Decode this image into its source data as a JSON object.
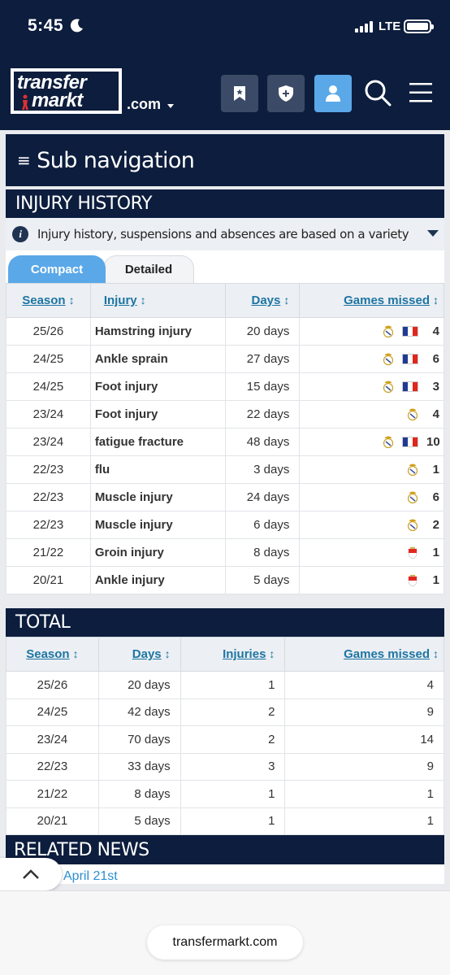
{
  "status_bar": {
    "time": "5:45",
    "network": "LTE"
  },
  "header": {
    "logo_line1": "transfer",
    "logo_line2": "markt",
    "domain": ".com"
  },
  "subnav": {
    "label": "Sub navigation"
  },
  "injury_history": {
    "title": "INJURY HISTORY",
    "info_text": "Injury history, suspensions and absences are based on a variety of media report..",
    "tabs": [
      "Compact",
      "Detailed"
    ],
    "columns": [
      "Season",
      "Injury",
      "Days",
      "Games missed"
    ],
    "rows": [
      {
        "season": "25/26",
        "injury": "Hamstring injury",
        "days": "20 days",
        "games": "4"
      },
      {
        "season": "24/25",
        "injury": "Ankle sprain",
        "days": "27 days",
        "games": "6"
      },
      {
        "season": "24/25",
        "injury": "Foot injury",
        "days": "15 days",
        "games": "3"
      },
      {
        "season": "23/24",
        "injury": "Foot injury",
        "days": "22 days",
        "games": "4"
      },
      {
        "season": "23/24",
        "injury": "fatigue fracture",
        "days": "48 days",
        "games": "10"
      },
      {
        "season": "22/23",
        "injury": "flu",
        "days": "3 days",
        "games": "1"
      },
      {
        "season": "22/23",
        "injury": "Muscle injury",
        "days": "24 days",
        "games": "6"
      },
      {
        "season": "22/23",
        "injury": "Muscle injury",
        "days": "6 days",
        "games": "2"
      },
      {
        "season": "21/22",
        "injury": "Groin injury",
        "days": "8 days",
        "games": "1"
      },
      {
        "season": "20/21",
        "injury": "Ankle injury",
        "days": "5 days",
        "games": "1"
      }
    ]
  },
  "total": {
    "title": "TOTAL",
    "columns": [
      "Season",
      "Days",
      "Injuries",
      "Games missed"
    ],
    "rows": [
      {
        "season": "25/26",
        "days": "20 days",
        "injuries": "1",
        "games": "4"
      },
      {
        "season": "24/25",
        "days": "42 days",
        "injuries": "2",
        "games": "9"
      },
      {
        "season": "23/24",
        "days": "70 days",
        "injuries": "2",
        "games": "14"
      },
      {
        "season": "22/23",
        "days": "33 days",
        "injuries": "3",
        "games": "9"
      },
      {
        "season": "21/22",
        "days": "8 days",
        "injuries": "1",
        "games": "1"
      },
      {
        "season": "20/21",
        "days": "5 days",
        "injuries": "1",
        "games": "1"
      }
    ]
  },
  "related_news": {
    "title": "RELATED NEWS",
    "first_date": "April 21st"
  },
  "browser": {
    "url": "transfermarkt.com"
  },
  "colors": {
    "navy": "#0c1d3d",
    "accent_blue": "#5aa8e8",
    "link_blue": "#1d75a3"
  }
}
